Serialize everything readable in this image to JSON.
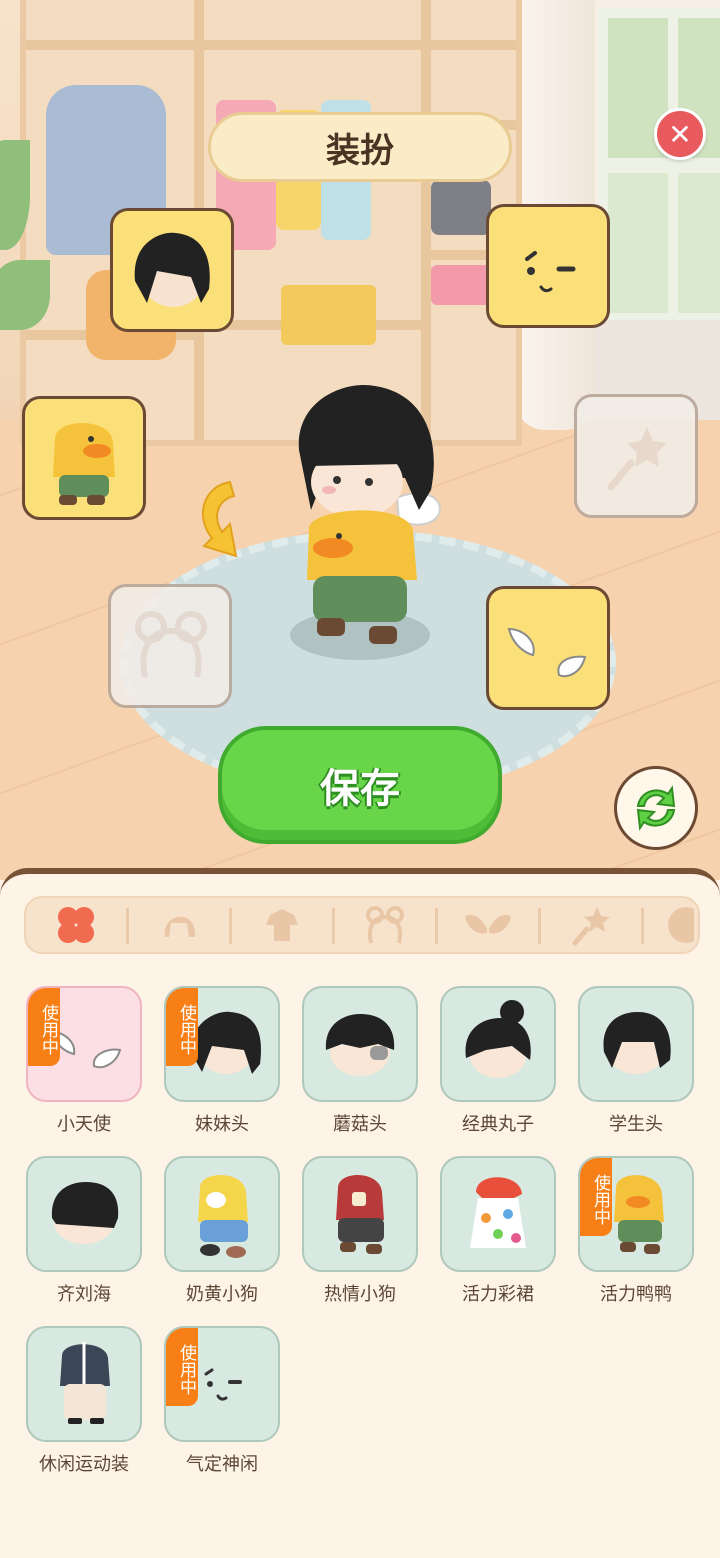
{
  "screen": {
    "title": "装扮",
    "close_icon": "close-icon",
    "save_label": "保存",
    "refresh_icon": "refresh-icon"
  },
  "equipment_slots": [
    {
      "id": "hair",
      "icon": "hair-icon",
      "equipped": true
    },
    {
      "id": "face",
      "icon": "face-expression-icon",
      "equipped": true
    },
    {
      "id": "outfit",
      "icon": "duck-outfit-icon",
      "equipped": true
    },
    {
      "id": "hand-item",
      "icon": "wand-icon",
      "equipped": false
    },
    {
      "id": "headband",
      "icon": "headband-icon",
      "equipped": false
    },
    {
      "id": "wings",
      "icon": "angel-wings-icon",
      "equipped": true
    }
  ],
  "category_tabs": [
    {
      "icon": "clover-icon",
      "active": true
    },
    {
      "icon": "hair-icon",
      "active": false
    },
    {
      "icon": "outfit-icon",
      "active": false
    },
    {
      "icon": "headband-icon",
      "active": false
    },
    {
      "icon": "wings-icon",
      "active": false
    },
    {
      "icon": "wand-icon",
      "active": false
    },
    {
      "icon": "face-icon",
      "active": false
    }
  ],
  "in_use_badge": "使用中",
  "items": [
    {
      "name": "小天使",
      "icon": "angel-wings-icon",
      "in_use": true,
      "selected": true
    },
    {
      "name": "妹妹头",
      "icon": "bob-hair-icon",
      "in_use": true
    },
    {
      "name": "蘑菇头",
      "icon": "mushroom-hair-icon",
      "in_use": false
    },
    {
      "name": "经典丸子",
      "icon": "bun-hair-icon",
      "in_use": false
    },
    {
      "name": "学生头",
      "icon": "student-hair-icon",
      "in_use": false
    },
    {
      "name": "齐刘海",
      "icon": "bangs-hair-icon",
      "in_use": false
    },
    {
      "name": "奶黄小狗",
      "icon": "yellow-dog-outfit-icon",
      "in_use": false
    },
    {
      "name": "热情小狗",
      "icon": "red-dog-outfit-icon",
      "in_use": false
    },
    {
      "name": "活力彩裙",
      "icon": "color-dress-icon",
      "in_use": false
    },
    {
      "name": "活力鸭鸭",
      "icon": "duck-outfit-icon",
      "in_use": true
    },
    {
      "name": "休闲运动装",
      "icon": "sportswear-icon",
      "in_use": false
    },
    {
      "name": "气定神闲",
      "icon": "calm-face-icon",
      "in_use": true
    }
  ],
  "colors": {
    "accent_green": "#69d64a",
    "badge_orange": "#f77f16",
    "slot_yellow": "#fbe07a",
    "close_red": "#e95a5f"
  }
}
